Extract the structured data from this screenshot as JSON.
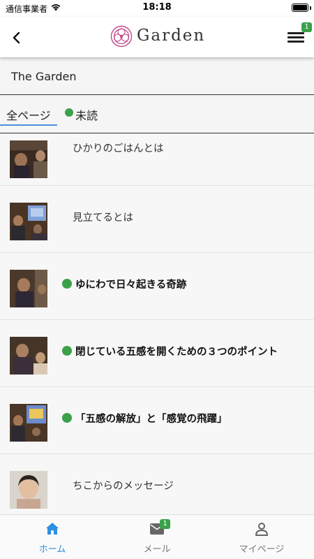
{
  "status_bar": {
    "carrier": "通信事業者",
    "time": "18:18"
  },
  "header": {
    "brand": "Garden",
    "menu_badge": "1",
    "icons": {
      "back": "chevron-left-icon",
      "logo": "flower-logo",
      "menu": "hamburger-menu-icon"
    },
    "colors": {
      "logo": "#c2478a",
      "badge": "#3aa14a"
    }
  },
  "section": {
    "title": "The Garden"
  },
  "tabs": {
    "all": "全ページ",
    "unread": "未読",
    "active_color": "#4a90d9"
  },
  "items": [
    {
      "title": "ひかりのごはんとは",
      "unread": false
    },
    {
      "title": "見立てるとは",
      "unread": false
    },
    {
      "title": "ゆにわで日々起きる奇跡",
      "unread": true
    },
    {
      "title": "閉じている五感を開くための３つのポイント",
      "unread": true
    },
    {
      "title": "「五感の解放」と「感覚の飛躍」",
      "unread": true
    },
    {
      "title": "ちこからのメッセージ",
      "unread": false
    }
  ],
  "nav": {
    "home": "ホーム",
    "mail": "メール",
    "mypage": "マイページ",
    "mail_badge": "1",
    "active_color": "#2f8fe0"
  }
}
